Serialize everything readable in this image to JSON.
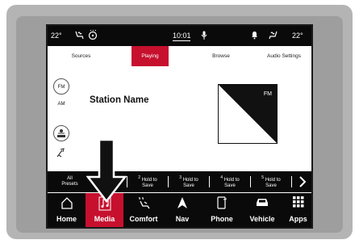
{
  "status": {
    "temp_left": "22°",
    "time": "10:01",
    "temp_right": "22°",
    "icons": [
      "heated-seat-icon",
      "heated-steering-icon",
      "microphone-icon",
      "bell-icon",
      "heated-seat-icon"
    ]
  },
  "tabs": [
    {
      "label": "Sources",
      "active": false
    },
    {
      "label": "Playing",
      "active": true
    },
    {
      "label": "Browse",
      "active": false
    },
    {
      "label": "Audio Settings",
      "active": false
    }
  ],
  "sources": [
    "FM",
    "AM",
    "SiriusXM",
    "Bluetooth"
  ],
  "now_playing": {
    "station": "Station Name",
    "album_label": "FM"
  },
  "presets": {
    "all_label_1": "All",
    "all_label_2": "Presets",
    "items": [
      {
        "number": "2",
        "line1": "Hold to",
        "line2": "Save"
      },
      {
        "number": "3",
        "line1": "Hold to",
        "line2": "Save"
      },
      {
        "number": "4",
        "line1": "Hold to",
        "line2": "Save"
      },
      {
        "number": "5",
        "line1": "Hold to",
        "line2": "Save"
      }
    ]
  },
  "nav": [
    {
      "label": "Home",
      "icon": "home-icon",
      "active": false
    },
    {
      "label": "Media",
      "icon": "music-note-icon",
      "active": true
    },
    {
      "label": "Comfort",
      "icon": "seat-fan-icon",
      "active": false
    },
    {
      "label": "Nav",
      "icon": "navigation-arrow-icon",
      "active": false
    },
    {
      "label": "Phone",
      "icon": "phone-icon",
      "active": false
    },
    {
      "label": "Vehicle",
      "icon": "car-icon",
      "active": false
    },
    {
      "label": "Apps",
      "icon": "grid-icon",
      "active": false
    }
  ],
  "colors": {
    "accent": "#c6102e",
    "bar": "#0a0a0a"
  }
}
